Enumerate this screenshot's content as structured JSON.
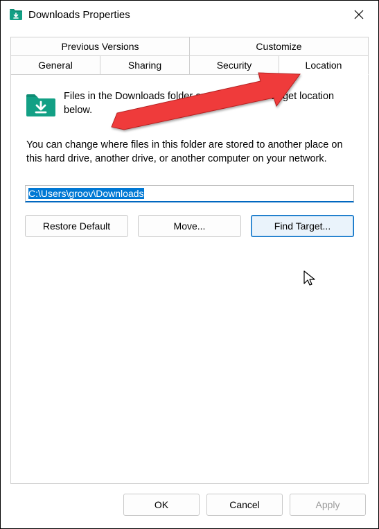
{
  "titlebar": {
    "title": "Downloads Properties"
  },
  "tabs": {
    "row1": [
      "Previous Versions",
      "Customize"
    ],
    "row2": [
      "General",
      "Sharing",
      "Security",
      "Location"
    ],
    "active": "Location"
  },
  "panel": {
    "intro": "Files in the Downloads folder are stored in the target location below.",
    "explain": "You can change where files in this folder are stored to another place on this hard drive, another drive, or another computer on your network.",
    "path_value": "C:\\Users\\groov\\Downloads",
    "buttons": {
      "restore": "Restore Default",
      "move": "Move...",
      "find": "Find Target..."
    }
  },
  "footer": {
    "ok": "OK",
    "cancel": "Cancel",
    "apply": "Apply"
  },
  "icons": {
    "title_icon": "downloads-folder-icon",
    "close": "close-icon",
    "folder": "downloads-folder-large-icon"
  }
}
